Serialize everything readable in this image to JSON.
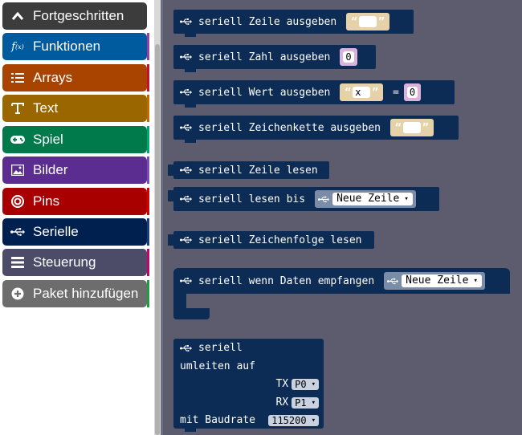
{
  "toolbox": {
    "categories": [
      {
        "label": "Fortgeschritten",
        "icon": "chevron-up-icon",
        "color": "#3c3c3c"
      },
      {
        "label": "Funktionen",
        "icon": "function-icon",
        "color": "#005a9e"
      },
      {
        "label": "Arrays",
        "icon": "list-icon",
        "color": "#a94400"
      },
      {
        "label": "Text",
        "icon": "text-icon",
        "color": "#996600"
      },
      {
        "label": "Spiel",
        "icon": "gamepad-icon",
        "color": "#007a4b"
      },
      {
        "label": "Bilder",
        "icon": "image-icon",
        "color": "#5c2d91"
      },
      {
        "label": "Pins",
        "icon": "pins-icon",
        "color": "#a80000"
      },
      {
        "label": "Serielle",
        "icon": "usb-icon",
        "color": "#002050"
      },
      {
        "label": "Steuerung",
        "icon": "control-icon",
        "color": "#4c4c68"
      },
      {
        "label": "Paket hinzufügen",
        "icon": "plus-circle-icon",
        "color": "#6d6d6d"
      }
    ]
  },
  "blocks": {
    "b1": {
      "label": "seriell Zeile ausgeben",
      "quote_open": "“",
      "quote_close": "”"
    },
    "b2": {
      "label": "seriell Zahl ausgeben",
      "value": "0"
    },
    "b3": {
      "label": "seriell Wert ausgeben",
      "quote_open": "“",
      "name": "x",
      "quote_close": "”",
      "equals": "=",
      "value": "0"
    },
    "b4": {
      "label": "seriell Zeichenkette ausgeben",
      "quote_open": "“",
      "quote_close": "”"
    },
    "b5": {
      "label": "seriell Zeile lesen"
    },
    "b6": {
      "label": "seriell lesen bis",
      "option": "Neue Zeile"
    },
    "b7": {
      "label": "seriell Zeichenfolge lesen"
    },
    "b8": {
      "label": "seriell wenn Daten empfangen",
      "option": "Neue Zeile"
    },
    "b9": {
      "line1": "seriell",
      "line2": "umleiten auf",
      "tx_label": "TX",
      "tx_value": "P0",
      "rx_label": "RX",
      "rx_value": "P1",
      "baud_label": "mit Baudrate",
      "baud_value": "115200"
    }
  },
  "caret": "▾"
}
